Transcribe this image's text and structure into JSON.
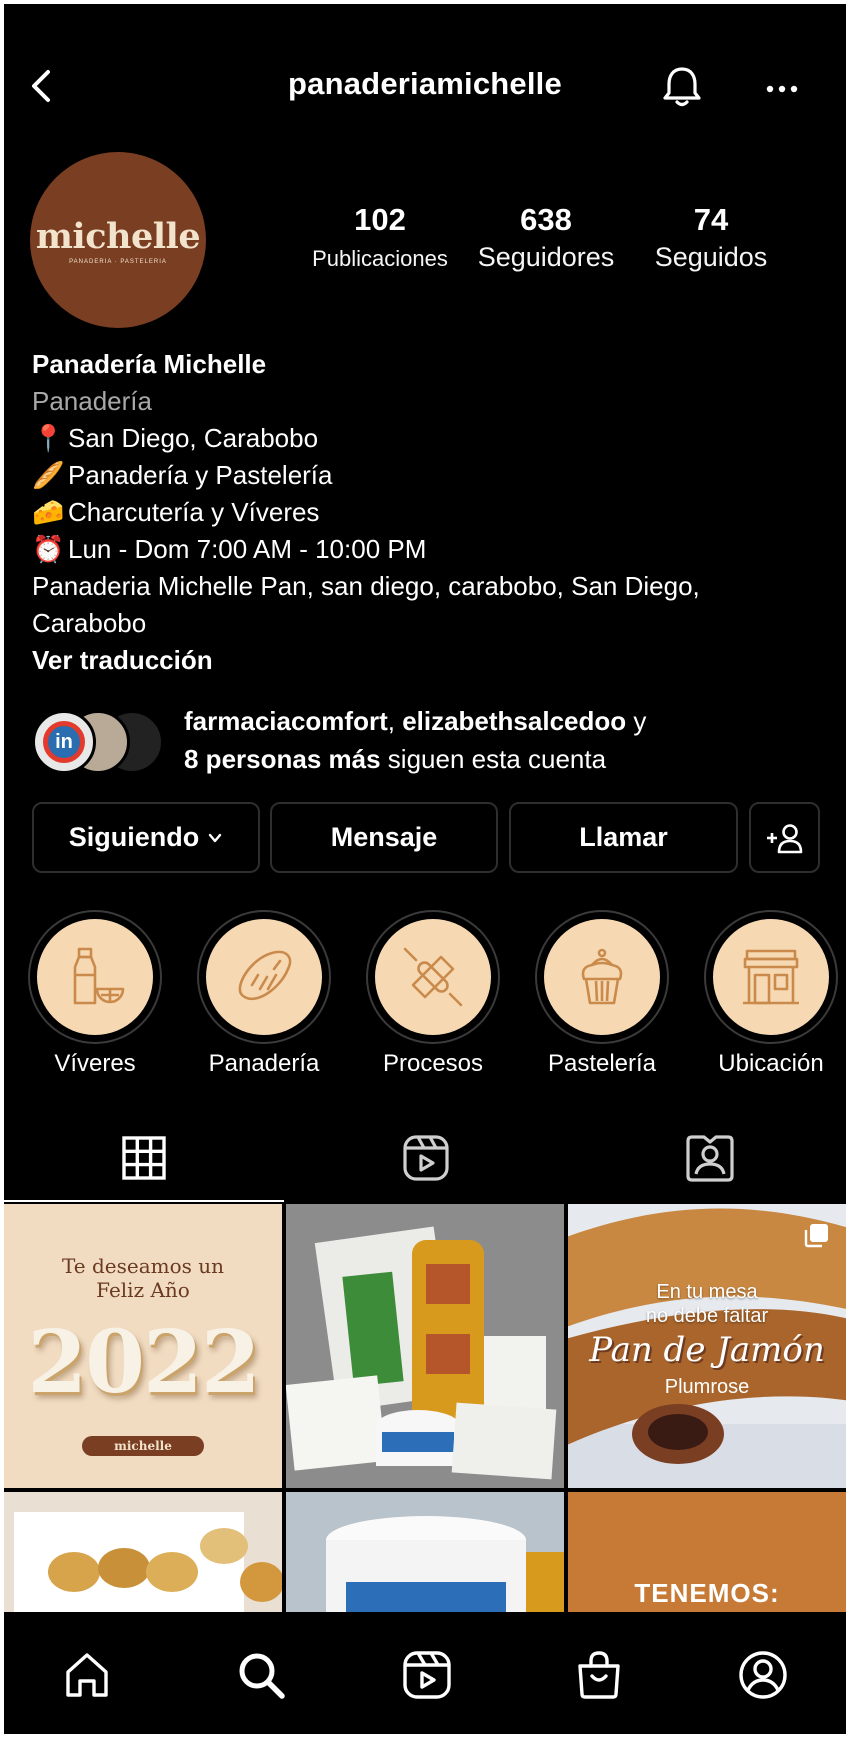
{
  "header": {
    "username": "panaderiamichelle"
  },
  "profile": {
    "avatar_logo": "michelle",
    "avatar_tag": "PANADERIA · PASTELERIA",
    "stats": [
      {
        "value": "102",
        "label": "Publicaciones"
      },
      {
        "value": "638",
        "label": "Seguidores"
      },
      {
        "value": "74",
        "label": "Seguidos"
      }
    ]
  },
  "bio": {
    "name": "Panadería Michelle",
    "category": "Panadería",
    "lines": [
      {
        "emoji": "📍",
        "text": "San Diego, Carabobo"
      },
      {
        "emoji": "🥖",
        "text": "Panadería y Pastelería"
      },
      {
        "emoji": "🧀",
        "text": "Charcutería y Víveres"
      },
      {
        "emoji": "⏰",
        "text": "Lun - Dom 7:00 AM - 10:00 PM"
      }
    ],
    "address_line1": "Panaderia Michelle Pan, san diego, carabobo, San Diego,",
    "address_line2": "Carabobo",
    "translate": "Ver traducción"
  },
  "followed_by": {
    "user1": "farmaciacomfort",
    "sep": ", ",
    "user2": "elizabethsalcedoo",
    "and": " y",
    "others": "8 personas más",
    "suffix": " siguen esta cuenta",
    "avatar1_text": "in"
  },
  "actions": {
    "following": "Siguiendo",
    "message": "Mensaje",
    "call": "Llamar",
    "add_user": "+"
  },
  "highlights": [
    {
      "label": "Víveres",
      "icon": "milk-bottle-icon"
    },
    {
      "label": "Panadería",
      "icon": "bread-icon"
    },
    {
      "label": "Procesos",
      "icon": "rolling-pin-icon"
    },
    {
      "label": "Pastelería",
      "icon": "cupcake-icon"
    },
    {
      "label": "Ubicación",
      "icon": "storefront-icon"
    }
  ],
  "tabs": [
    "grid-icon",
    "reels-icon",
    "tagged-icon"
  ],
  "posts": {
    "p1_line1": "Te deseamos un",
    "p1_line2": "Feliz Año",
    "p1_year": "2022",
    "p1_brand": "michelle",
    "p3_line1": "En tu mesa",
    "p3_line2": "no debe faltar",
    "p3_script": "Pan de Jamón",
    "p3_sub": "Plumrose",
    "p6_banner": "TENEMOS:"
  },
  "colors": {
    "background": "#000000",
    "highlight_fill": "#f6d9b3",
    "highlight_stroke": "#c98a4b",
    "avatar_brown": "#7a3e22",
    "button_border": "#2e2e2e"
  },
  "nav": [
    "home-icon",
    "search-icon",
    "reels-icon",
    "shop-icon",
    "profile-icon"
  ]
}
